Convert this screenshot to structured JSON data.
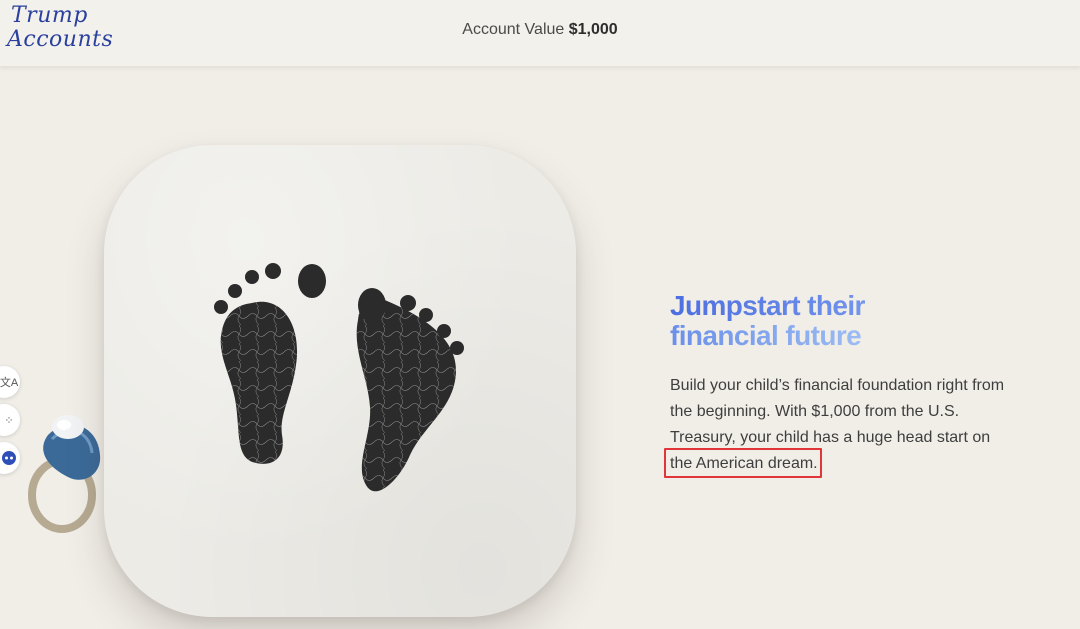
{
  "header": {
    "logo_line1": "Trump",
    "logo_line2": "Accounts",
    "account_label": "Account Value",
    "account_value": "$1,000"
  },
  "side_widgets": [
    {
      "icon": "translate-icon",
      "glyph": "文A"
    },
    {
      "icon": "apps-grid-icon",
      "glyph": "⁘"
    },
    {
      "icon": "assistant-face-icon",
      "glyph": "••"
    }
  ],
  "hero": {
    "headline_line1": "Jumpstart their",
    "headline_line2": "financial future",
    "body_lines": [
      "Build your child’s financial foundation right from",
      "the beginning. With $1,000 from the U.S.",
      "Treasury, your child has a huge head start on",
      "the American dream."
    ],
    "image": "baby-footprints-card",
    "highlighted_phrase": "the American dream."
  },
  "colors": {
    "background": "#f1eee8",
    "logo": "#2a3f9e",
    "headline_gradient_start": "#4d6ee0",
    "headline_gradient_end": "#b6d2f6",
    "highlight_border": "#e0363a"
  }
}
